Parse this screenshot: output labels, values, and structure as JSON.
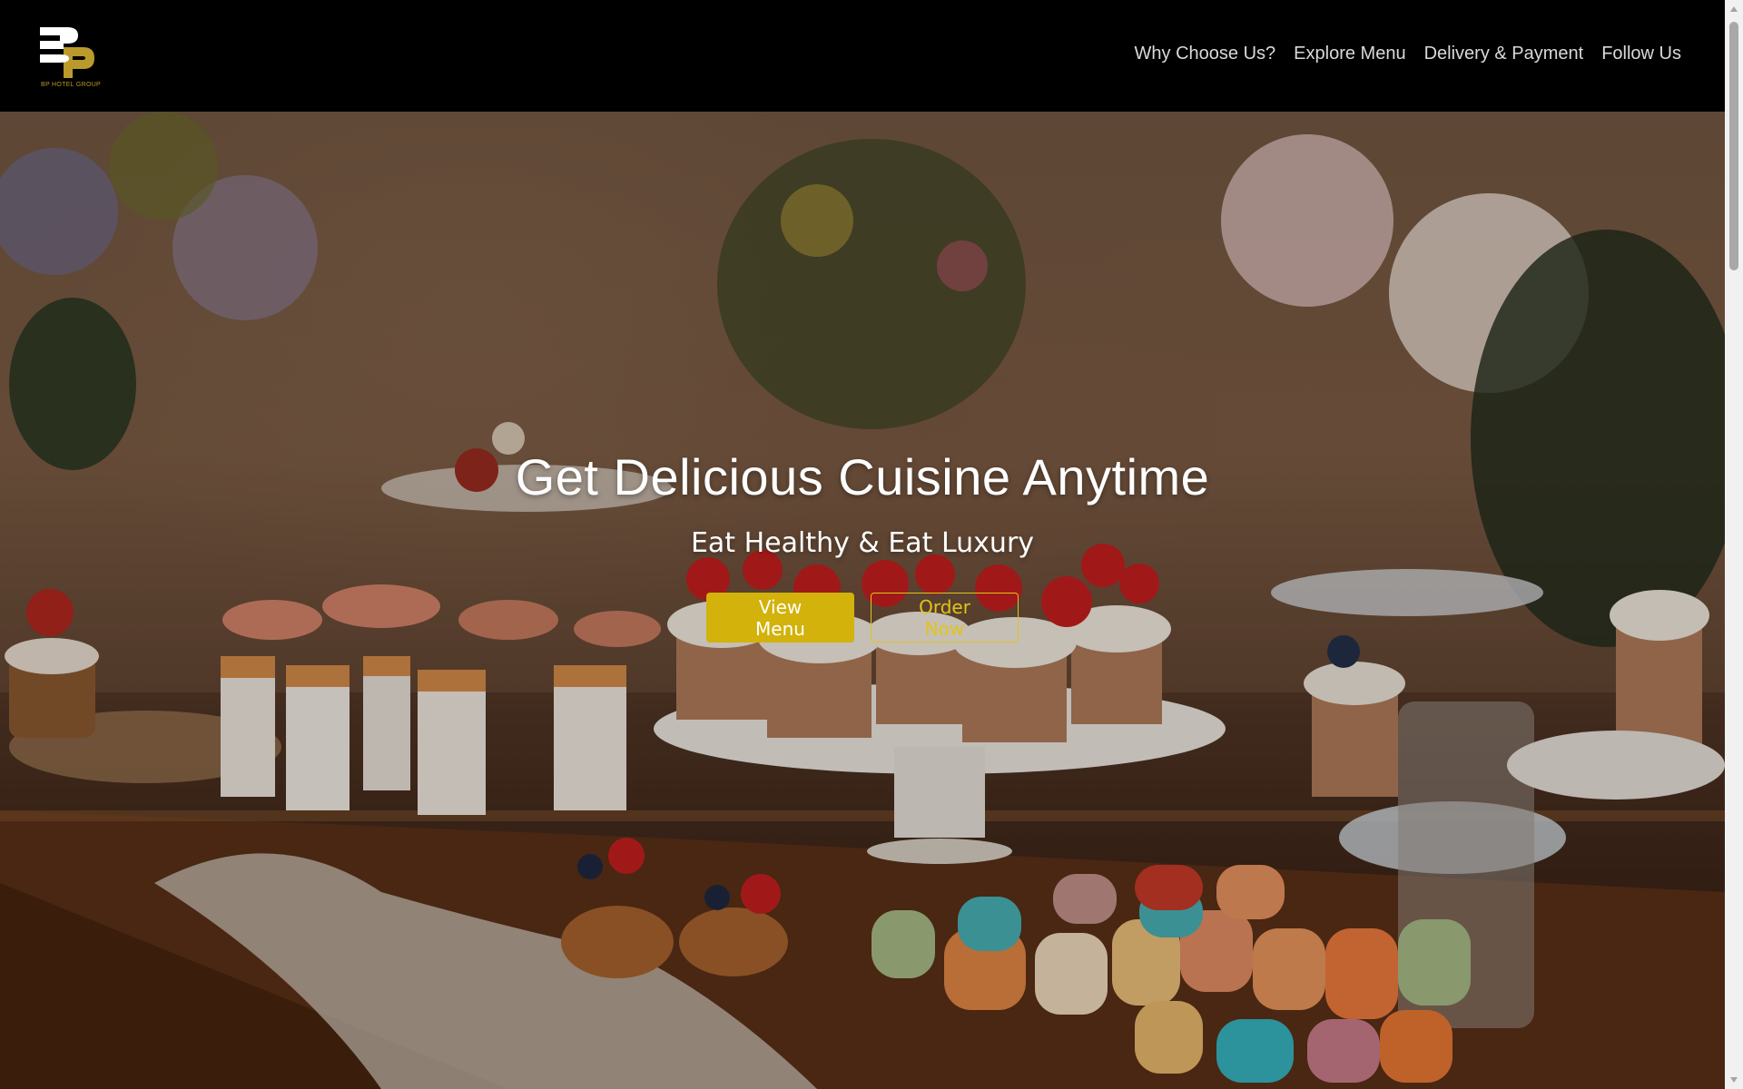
{
  "brand": {
    "logo_caption": "BP HOTEL GROUP",
    "logo_icon": "bp-monogram",
    "gold_color": "#b99a2b"
  },
  "nav": {
    "items": [
      {
        "label": "Why Choose Us?"
      },
      {
        "label": "Explore Menu"
      },
      {
        "label": "Delivery & Payment"
      },
      {
        "label": "Follow Us"
      }
    ]
  },
  "hero": {
    "title": "Get Delicious Cuisine Anytime",
    "subtitle": "Eat Healthy & Eat Luxury",
    "primary_button": "View Menu",
    "secondary_button": "Order Now",
    "accent_color": "#d2b20b"
  },
  "scrollbar": {
    "up_icon": "triangle-up-icon",
    "down_icon": "triangle-down-icon"
  }
}
